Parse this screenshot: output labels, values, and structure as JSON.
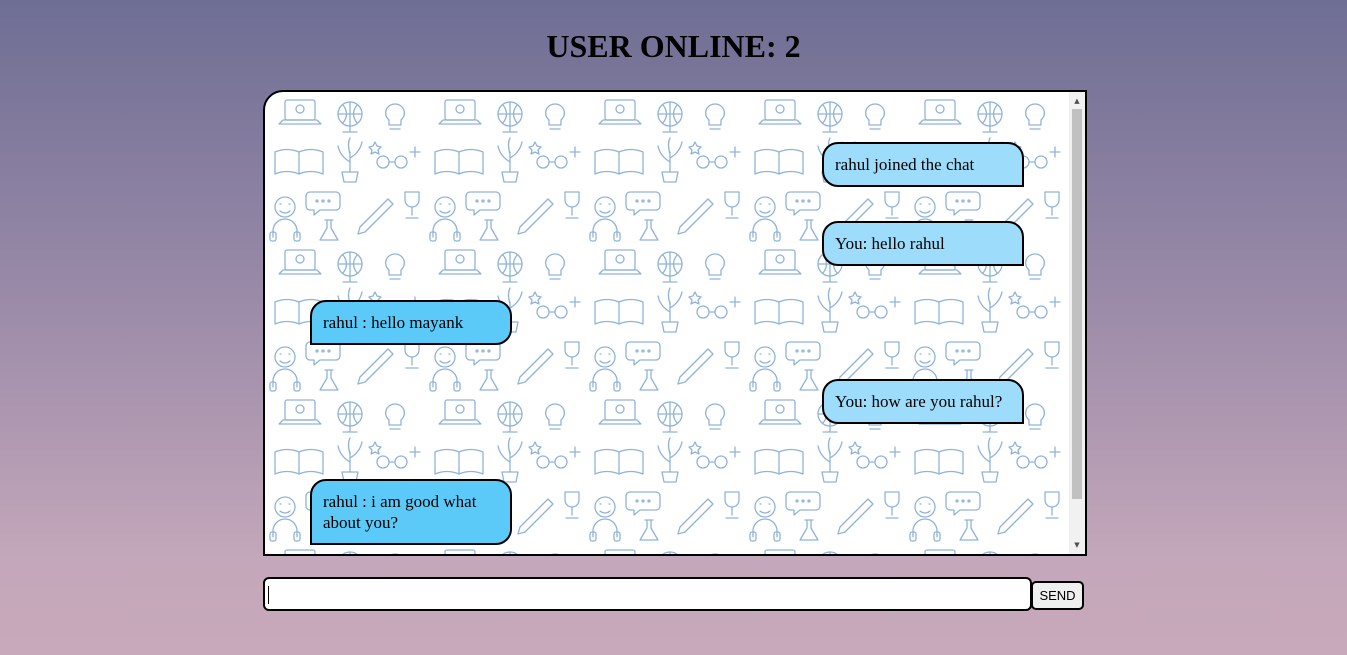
{
  "header": {
    "title": "USER ONLINE: 2"
  },
  "chat": {
    "messages": [
      {
        "side": "right",
        "text": "rahul joined the chat"
      },
      {
        "side": "right",
        "text": "You: hello rahul"
      },
      {
        "side": "left",
        "text": "rahul : hello mayank"
      },
      {
        "side": "right",
        "text": "You: how are you rahul?"
      },
      {
        "side": "left",
        "text": "rahul : i am good what about you?"
      }
    ]
  },
  "composer": {
    "input_value": "",
    "send_label": "SEND"
  },
  "colors": {
    "incoming_bubble": "#5ccaf8",
    "outgoing_bubble": "#9ddcfb",
    "pattern_stroke": "#8fb3d9"
  }
}
